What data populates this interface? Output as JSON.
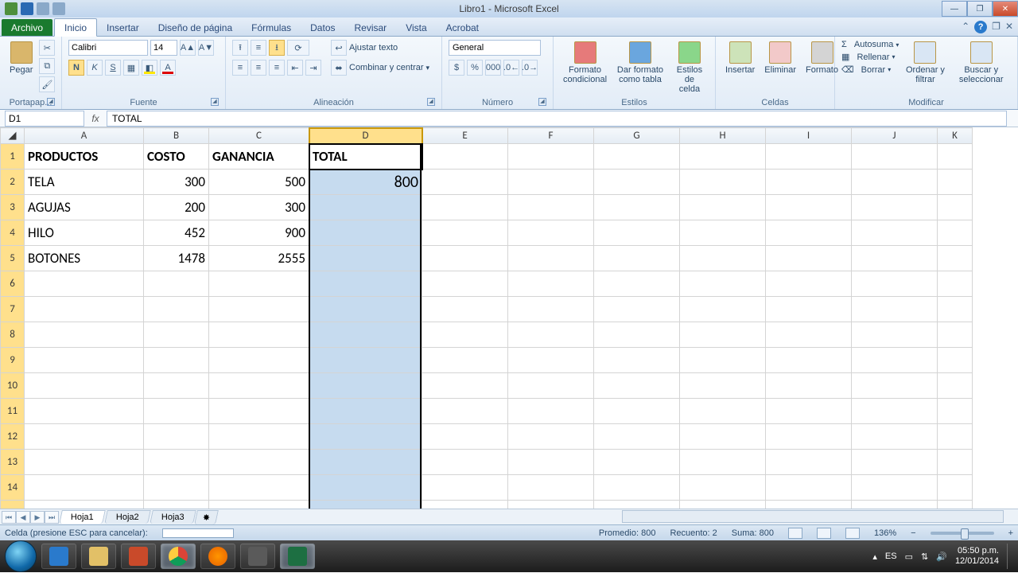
{
  "window": {
    "title": "Libro1 - Microsoft Excel"
  },
  "tabs": {
    "file": "Archivo",
    "list": [
      "Inicio",
      "Insertar",
      "Diseño de página",
      "Fórmulas",
      "Datos",
      "Revisar",
      "Vista",
      "Acrobat"
    ],
    "active": "Inicio"
  },
  "ribbon": {
    "clipboard": {
      "paste": "Pegar",
      "label": "Portapap..."
    },
    "font": {
      "name": "Calibri",
      "size": "14",
      "label": "Fuente"
    },
    "align": {
      "wrap": "Ajustar texto",
      "merge": "Combinar y centrar",
      "label": "Alineación"
    },
    "number": {
      "format": "General",
      "label": "Número"
    },
    "styles": {
      "cond": "Formato condicional",
      "table": "Dar formato como tabla",
      "cell": "Estilos de celda",
      "label": "Estilos"
    },
    "cells": {
      "insert": "Insertar",
      "delete": "Eliminar",
      "format": "Formato",
      "label": "Celdas"
    },
    "editing": {
      "sum": "Autosuma",
      "fill": "Rellenar",
      "clear": "Borrar",
      "sort": "Ordenar y filtrar",
      "find": "Buscar y seleccionar",
      "label": "Modificar"
    }
  },
  "namebox": "D1",
  "formula": "TOTAL",
  "columns": [
    "A",
    "B",
    "C",
    "D",
    "E",
    "F",
    "G",
    "H",
    "I",
    "J",
    "K"
  ],
  "headers": {
    "A": "PRODUCTOS",
    "B": "COSTO",
    "C": "GANANCIA",
    "D": "TOTAL"
  },
  "rows": [
    {
      "A": "TELA",
      "B": "300",
      "C": "500",
      "D": "800"
    },
    {
      "A": "AGUJAS",
      "B": "200",
      "C": "300",
      "D": ""
    },
    {
      "A": "HILO",
      "B": "452",
      "C": "900",
      "D": ""
    },
    {
      "A": "BOTONES",
      "B": "1478",
      "C": "2555",
      "D": ""
    }
  ],
  "sheets": [
    "Hoja1",
    "Hoja2",
    "Hoja3"
  ],
  "status": {
    "mode": "Celda (presione ESC para cancelar):",
    "avg": "Promedio: 800",
    "count": "Recuento: 2",
    "sum": "Suma: 800",
    "zoom": "136%"
  },
  "tray": {
    "lang": "ES",
    "time": "05:50 p.m.",
    "date": "12/01/2014"
  },
  "chart_data": {
    "type": "table",
    "columns": [
      "PRODUCTOS",
      "COSTO",
      "GANANCIA",
      "TOTAL"
    ],
    "rows": [
      [
        "TELA",
        300,
        500,
        800
      ],
      [
        "AGUJAS",
        200,
        300,
        null
      ],
      [
        "HILO",
        452,
        900,
        null
      ],
      [
        "BOTONES",
        1478,
        2555,
        null
      ]
    ]
  }
}
